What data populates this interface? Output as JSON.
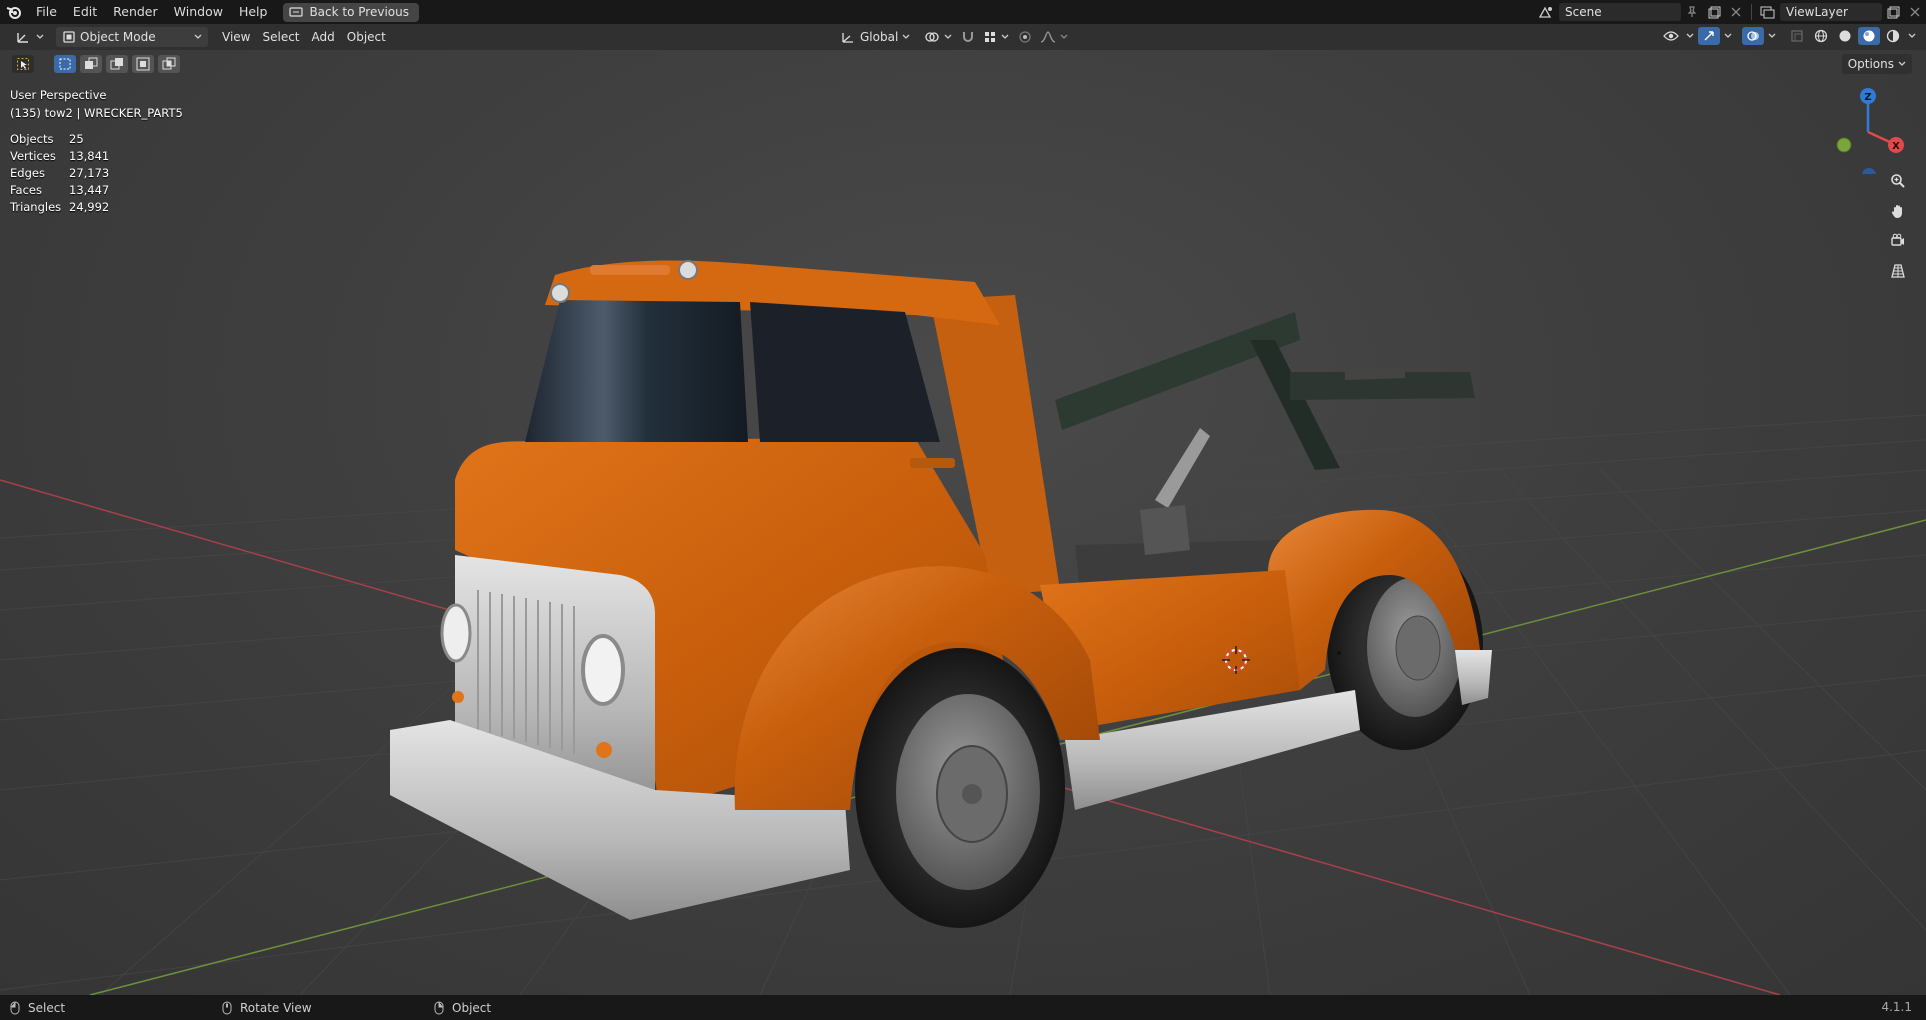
{
  "menu": {
    "items": [
      "File",
      "Edit",
      "Render",
      "Window",
      "Help"
    ],
    "back_label": "Back to Previous"
  },
  "topbar": {
    "scene": "Scene",
    "view_layer": "ViewLayer"
  },
  "header": {
    "mode": "Object Mode",
    "menus": [
      "View",
      "Select",
      "Add",
      "Object"
    ],
    "transform_orientation": "Global"
  },
  "viewport": {
    "perspective": "User Perspective",
    "object_info": "(135) tow2 | WRECKER_PART5",
    "options_label": "Options",
    "gizmo": {
      "z": "Z",
      "x": "X"
    },
    "stats": [
      {
        "label": "Objects",
        "value": "25"
      },
      {
        "label": "Vertices",
        "value": "13,841"
      },
      {
        "label": "Edges",
        "value": "27,173"
      },
      {
        "label": "Faces",
        "value": "13,447"
      },
      {
        "label": "Triangles",
        "value": "24,992"
      }
    ]
  },
  "statusbar": {
    "select": "Select",
    "rotate": "Rotate View",
    "object": "Object",
    "version": "4.1.1"
  },
  "colors": {
    "truck_body": "#d2690f",
    "bumper": "#c2c2c2",
    "gizmo_z": "#2f7bd8",
    "gizmo_x": "#e04a4a",
    "gizmo_y": "#7aa53a",
    "axis_x_line": "#a8404a",
    "axis_y_line": "#6d8f3c"
  }
}
